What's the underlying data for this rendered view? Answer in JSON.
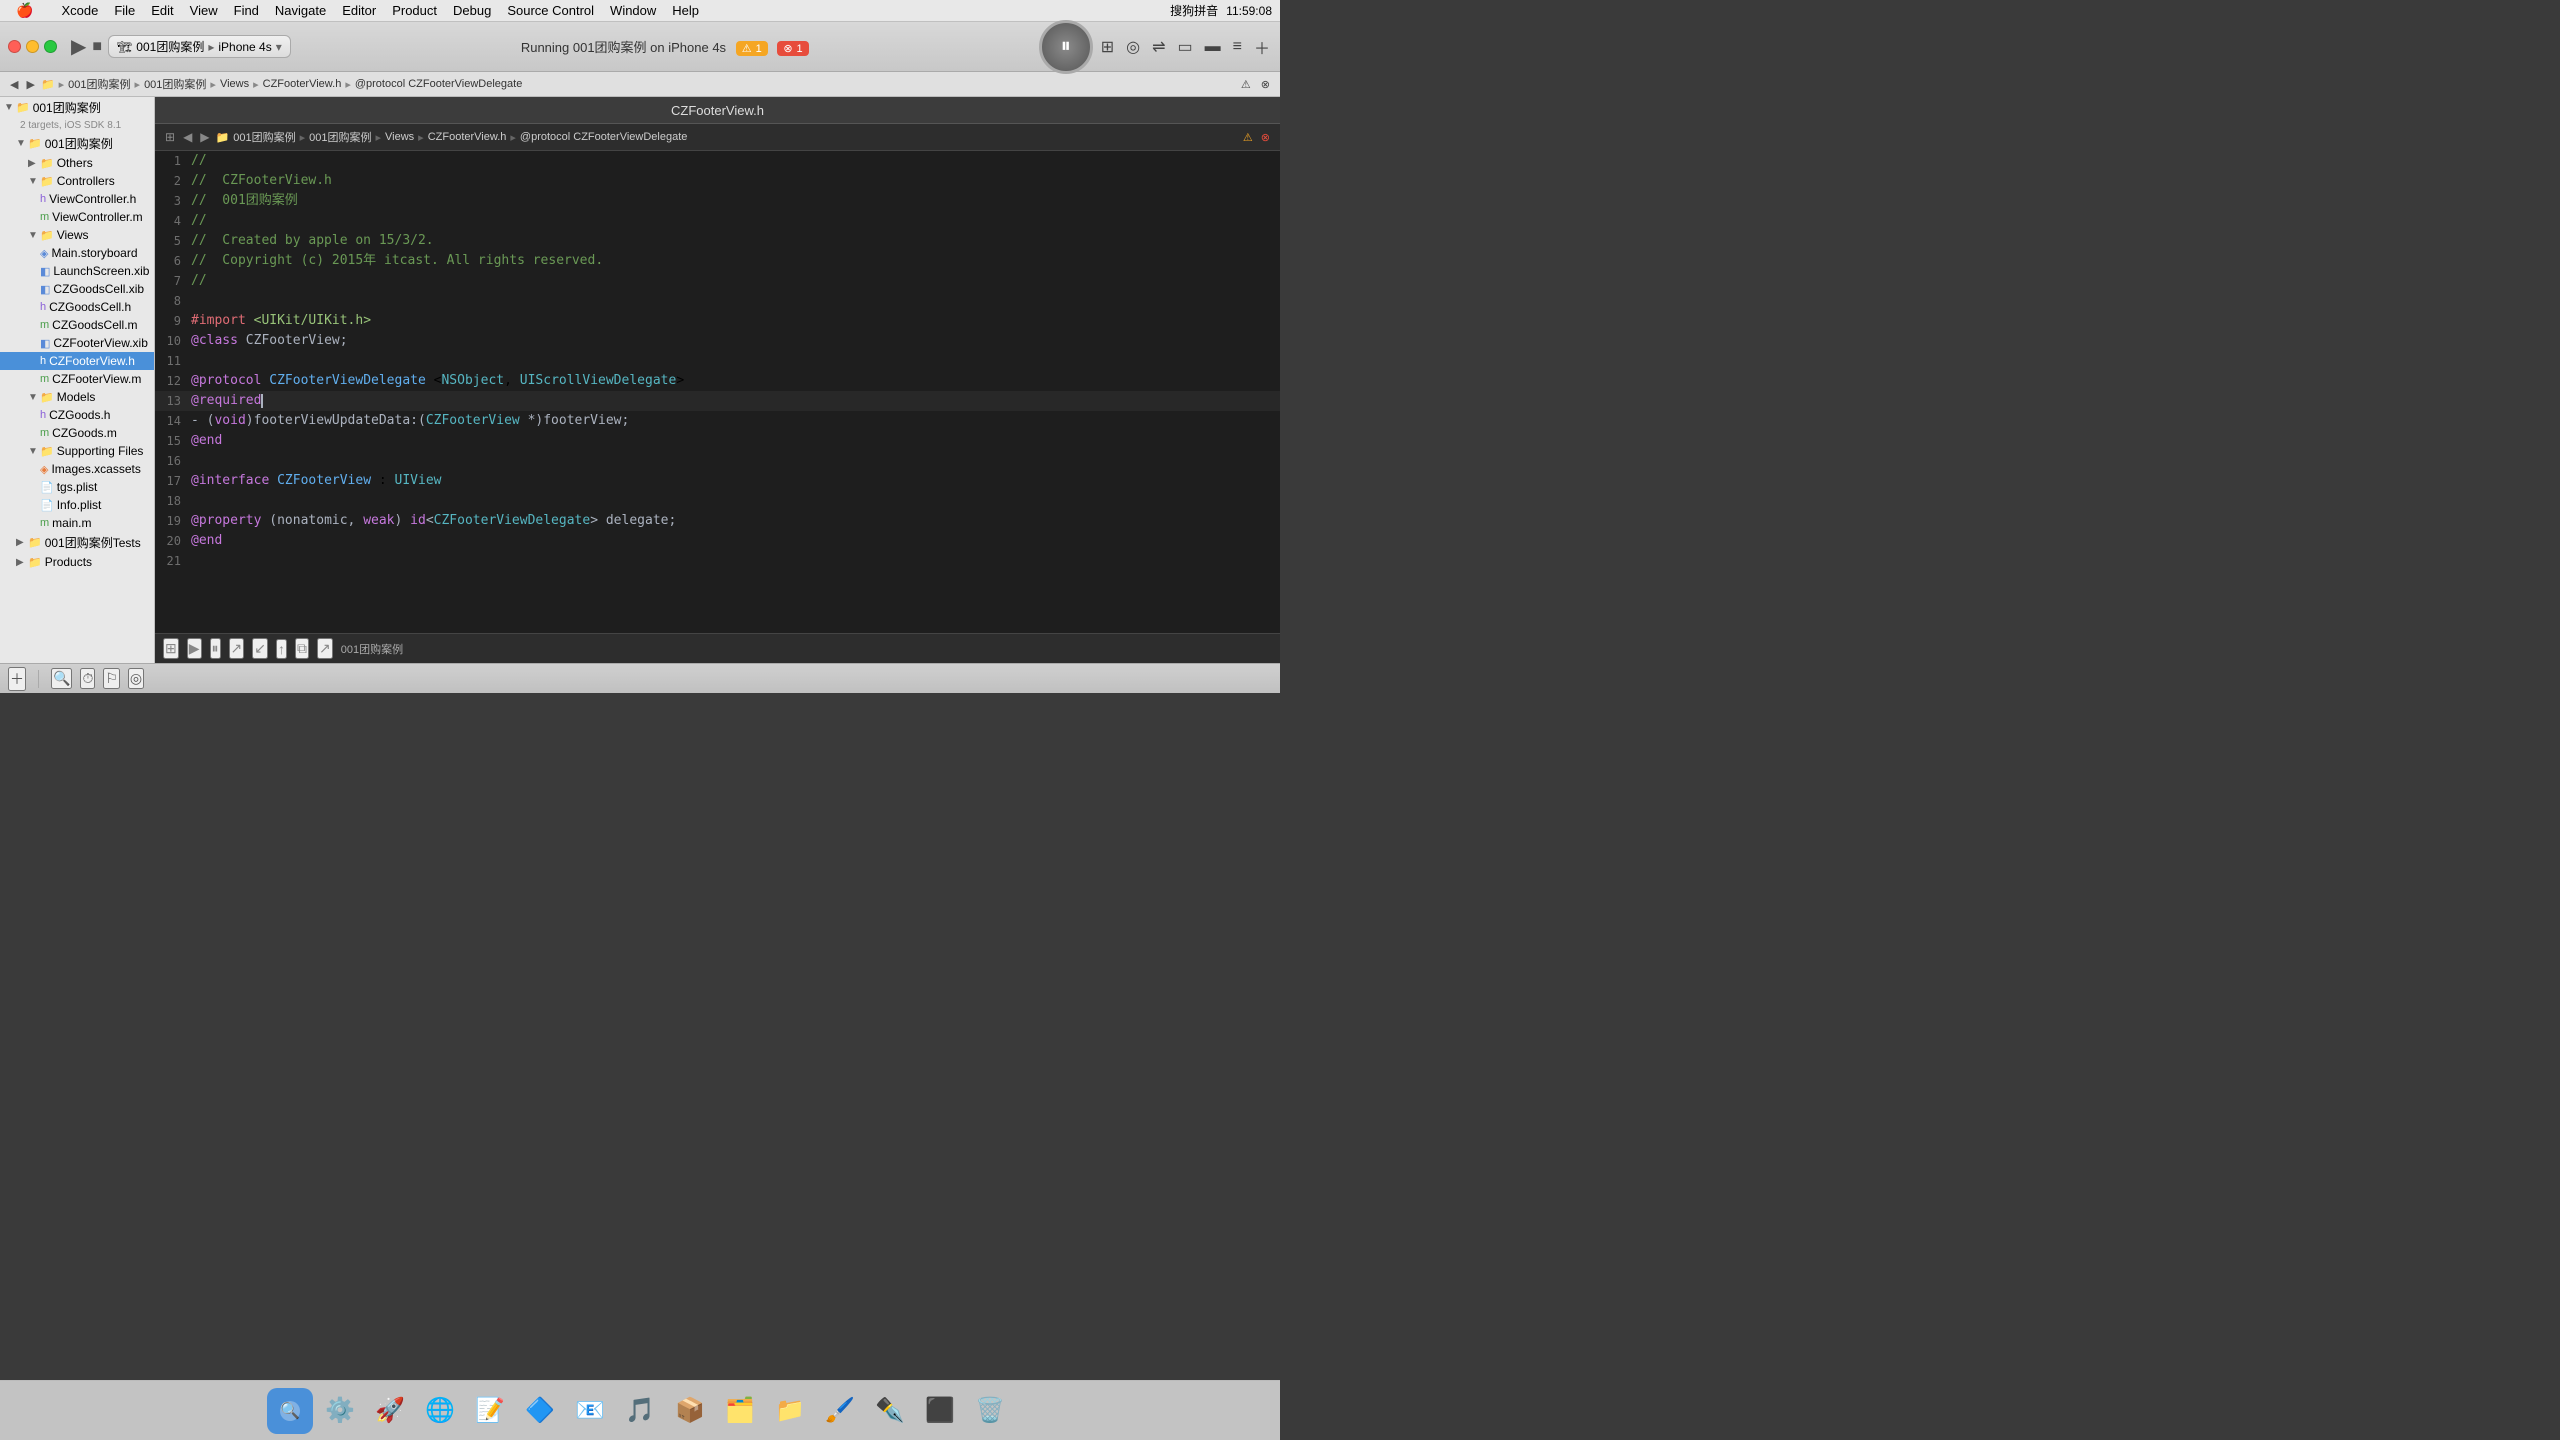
{
  "menu_bar": {
    "apple": "🍎",
    "items": [
      "Xcode",
      "File",
      "Edit",
      "View",
      "Find",
      "Navigate",
      "Editor",
      "Product",
      "Debug",
      "Source Control",
      "Window",
      "Help"
    ],
    "right": "11:59:08",
    "input_method": "搜狗拼音"
  },
  "toolbar": {
    "run_label": "▶",
    "stop_label": "■",
    "scheme": "001团购案例",
    "device": "iPhone 4s",
    "status": "Running 001团购案例 on iPhone 4s",
    "warning_count": "1",
    "error_count": "1"
  },
  "nav_path": {
    "segments": [
      "001团购案例",
      "001团购案例",
      "Views",
      "CZFooterView.h",
      "@protocol CZFooterViewDelegate"
    ]
  },
  "editor_title": "CZFooterView.h",
  "sidebar": {
    "project": "001团购案例",
    "project_detail": "2 targets, iOS SDK 8.1",
    "items": [
      {
        "level": 1,
        "label": "001团购案例",
        "type": "folder",
        "expanded": true
      },
      {
        "level": 2,
        "label": "Others",
        "type": "folder",
        "expanded": true
      },
      {
        "level": 2,
        "label": "Controllers",
        "type": "folder",
        "expanded": true
      },
      {
        "level": 3,
        "label": "ViewController.h",
        "type": "h"
      },
      {
        "level": 3,
        "label": "ViewController.m",
        "type": "m"
      },
      {
        "level": 2,
        "label": "Views",
        "type": "folder",
        "expanded": true
      },
      {
        "level": 3,
        "label": "Main.storyboard",
        "type": "storyboard"
      },
      {
        "level": 3,
        "label": "LaunchScreen.xib",
        "type": "xib"
      },
      {
        "level": 3,
        "label": "CZGoodsCell.xib",
        "type": "xib"
      },
      {
        "level": 3,
        "label": "CZGoodsCell.h",
        "type": "h"
      },
      {
        "level": 3,
        "label": "CZGoodsCell.m",
        "type": "m"
      },
      {
        "level": 3,
        "label": "CZFooterView.xib",
        "type": "xib"
      },
      {
        "level": 3,
        "label": "CZFooterView.h",
        "type": "h",
        "selected": true
      },
      {
        "level": 3,
        "label": "CZFooterView.m",
        "type": "m"
      },
      {
        "level": 2,
        "label": "Models",
        "type": "folder",
        "expanded": true
      },
      {
        "level": 3,
        "label": "CZGoods.h",
        "type": "h"
      },
      {
        "level": 3,
        "label": "CZGoods.m",
        "type": "m"
      },
      {
        "level": 2,
        "label": "Supporting Files",
        "type": "folder",
        "expanded": true
      },
      {
        "level": 3,
        "label": "Images.xcassets",
        "type": "asset"
      },
      {
        "level": 3,
        "label": "tgs.plist",
        "type": "plist"
      },
      {
        "level": 3,
        "label": "Info.plist",
        "type": "plist"
      },
      {
        "level": 3,
        "label": "main.m",
        "type": "m"
      },
      {
        "level": 1,
        "label": "001团购案例Tests",
        "type": "folder",
        "expanded": false
      },
      {
        "level": 1,
        "label": "Products",
        "type": "folder",
        "expanded": false
      }
    ]
  },
  "code": {
    "lines": [
      {
        "num": 1,
        "content": "//",
        "type": "comment"
      },
      {
        "num": 2,
        "content": "//  CZFooterView.h",
        "type": "comment"
      },
      {
        "num": 3,
        "content": "//  001团购案例",
        "type": "comment"
      },
      {
        "num": 4,
        "content": "//",
        "type": "comment"
      },
      {
        "num": 5,
        "content": "//  Created by apple on 15/3/2.",
        "type": "comment"
      },
      {
        "num": 6,
        "content": "//  Copyright (c) 2015年 itcast. All rights reserved.",
        "type": "comment"
      },
      {
        "num": 7,
        "content": "//",
        "type": "comment"
      },
      {
        "num": 8,
        "content": "",
        "type": "blank"
      },
      {
        "num": 9,
        "content": "#import <UIKit/UIKit.h>",
        "type": "directive"
      },
      {
        "num": 10,
        "content": "@class CZFooterView;",
        "type": "code"
      },
      {
        "num": 11,
        "content": "",
        "type": "blank"
      },
      {
        "num": 12,
        "content": "@protocol CZFooterViewDelegate <NSObject, UIScrollViewDelegate>",
        "type": "code"
      },
      {
        "num": 13,
        "content": "@required",
        "type": "keyword_line",
        "cursor": true
      },
      {
        "num": 14,
        "content": "- (void)footerViewUpdateData:(CZFooterView *)footerView;",
        "type": "code"
      },
      {
        "num": 15,
        "content": "@end",
        "type": "keyword_line"
      },
      {
        "num": 16,
        "content": "",
        "type": "blank"
      },
      {
        "num": 17,
        "content": "@interface CZFooterView : UIView",
        "type": "code"
      },
      {
        "num": 18,
        "content": "",
        "type": "blank"
      },
      {
        "num": 19,
        "content": "@property (nonatomic, weak) id<CZFooterViewDelegate> delegate;",
        "type": "code"
      },
      {
        "num": 20,
        "content": "@end",
        "type": "keyword_line"
      },
      {
        "num": 21,
        "content": "",
        "type": "blank"
      }
    ]
  },
  "bottom_toolbar": {
    "project_label": "001团购案例"
  },
  "dock": {
    "items": [
      "🔍",
      "⚙️",
      "🚀",
      "🌐",
      "📝",
      "🔷",
      "📧",
      "🎵",
      "📦",
      "🗂️",
      "📁",
      "🗑️"
    ]
  }
}
